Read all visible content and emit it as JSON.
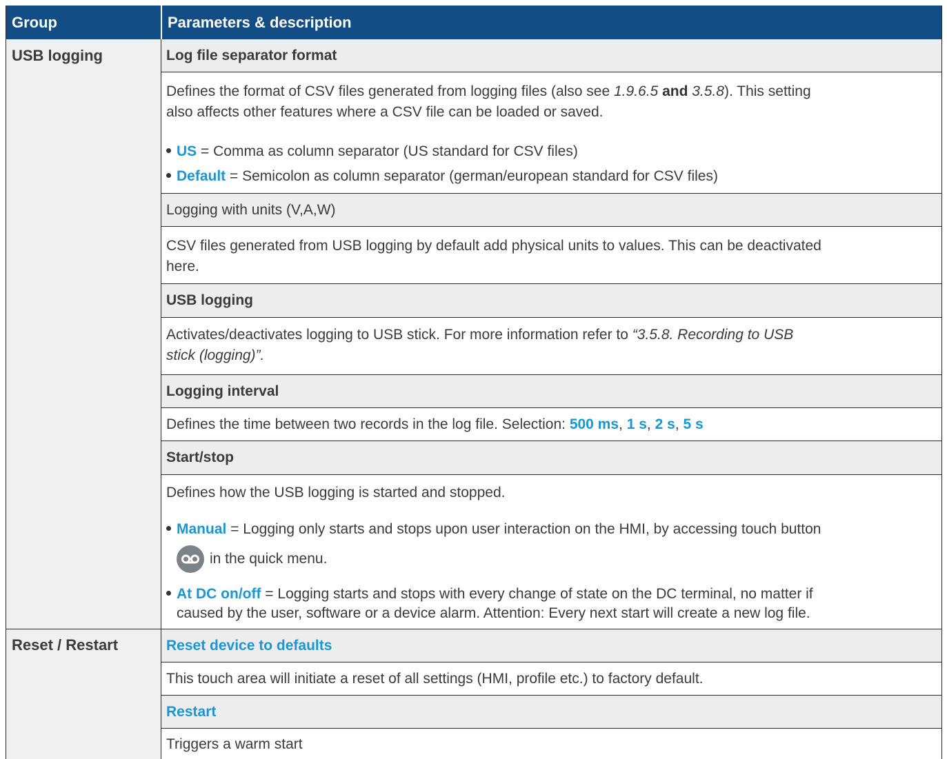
{
  "header": {
    "group": "Group",
    "params": "Parameters & description"
  },
  "groups": [
    {
      "label": "USB logging"
    },
    {
      "label": "Reset / Restart"
    }
  ],
  "usb": {
    "sep_title": "Log file separator format",
    "sep_desc_1": "Defines the format of CSV files generated from logging files (also see ",
    "sep_ref_1": "1.9.6.5",
    "sep_and": " and ",
    "sep_ref_2": "3.5.8",
    "sep_desc_2": "). This setting",
    "sep_desc_3": "also affects other features where a CSV file can be loaded or saved.",
    "us_key": "US",
    "us_text": " = Comma as column separator (US standard for CSV files)",
    "default_key": "Default",
    "default_text": " = Semicolon as column separator (german/european standard for CSV files)",
    "units_title": "Logging with units (V,A,W)",
    "units_desc_1": "CSV files generated from USB logging by default add physical units to values. This can be deactivated",
    "units_desc_2": "here.",
    "log_title": "USB logging",
    "log_desc_1": "Activates/deactivates logging to USB stick. For more information refer to ",
    "log_ref_1": "“3.5.8. Recording to USB",
    "log_ref_2": "stick (logging)”.",
    "interval_title": "Logging interval",
    "interval_desc": "Defines the time between two records in the log file. Selection: ",
    "interval_opts": [
      "500 ms",
      "1 s",
      "2 s",
      "5 s"
    ],
    "interval_sep": ", ",
    "ss_title": "Start/stop",
    "ss_desc": "Defines how the USB logging is started and stopped.",
    "manual_key": "Manual",
    "manual_text": " = Logging only starts and stops upon user interaction on the HMI, by accessing touch button",
    "manual_text_2": "in the quick menu.",
    "dc_key": "At DC on/off",
    "dc_text_1": " = Logging starts and stops with every change of state on the DC terminal, no matter if",
    "dc_text_2": "caused by the user, software or a device alarm. Attention: Every next start will create a new log file."
  },
  "reset": {
    "reset_title": "Reset device to defaults",
    "reset_desc": "This touch area will initiate a reset of all settings (HMI, profile etc.) to factory default.",
    "restart_title": "Restart",
    "restart_desc": "Triggers a warm start"
  },
  "colors": {
    "header_bg": "#124d85",
    "accent": "#1a96d4",
    "row_gray": "#ededed"
  },
  "icons": {
    "record_button": "record-icon"
  }
}
